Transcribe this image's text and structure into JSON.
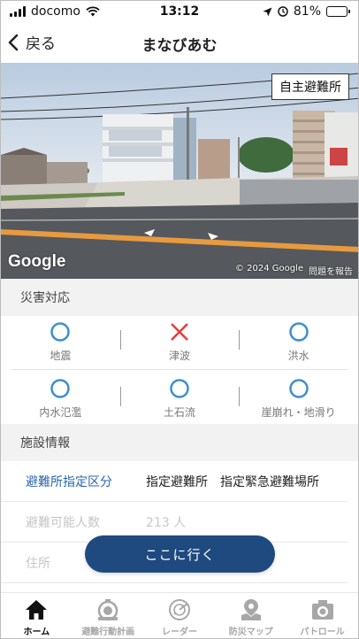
{
  "status_bar": {
    "carrier": "docomo",
    "time": "13:12",
    "battery": "81%",
    "battery_level": 0.81
  },
  "nav": {
    "back_label": "戻る",
    "title": "まなびあむ"
  },
  "street_view": {
    "tag": "自主避難所",
    "brand": "Google",
    "copyright": "© 2024 Google",
    "report": "問題を報告"
  },
  "disaster": {
    "header": "災害対応",
    "items": [
      {
        "label": "地震",
        "mark": "circle-icon",
        "color": "#3e8ed0"
      },
      {
        "label": "津波",
        "mark": "cross-icon",
        "color": "#e5403e"
      },
      {
        "label": "洪水",
        "mark": "circle-icon",
        "color": "#3e8ed0"
      },
      {
        "label": "内水氾濫",
        "mark": "circle-icon",
        "color": "#3e8ed0"
      },
      {
        "label": "土石流",
        "mark": "circle-icon",
        "color": "#3e8ed0"
      },
      {
        "label": "崖崩れ・地滑り",
        "mark": "circle-icon",
        "color": "#3e8ed0"
      }
    ]
  },
  "facility": {
    "header": "施設情報",
    "rows": [
      {
        "key": "避難所指定区分",
        "values": [
          "指定避難所",
          "指定緊急避難場所"
        ]
      },
      {
        "key": "避難可能人数",
        "values": [
          "213 人"
        ]
      },
      {
        "key": "住所",
        "values": []
      }
    ]
  },
  "go_button": "ここに行く",
  "tabs": [
    {
      "label": "ホーム",
      "icon": "home-icon",
      "active": true
    },
    {
      "label": "避難行動計画",
      "icon": "timer-icon",
      "active": false
    },
    {
      "label": "レーダー",
      "icon": "radar-icon",
      "active": false
    },
    {
      "label": "防災マップ",
      "icon": "map-pin-icon",
      "active": false
    },
    {
      "label": "パトロール",
      "icon": "camera-icon",
      "active": false
    }
  ],
  "colors": {
    "accent_blue": "#2b66b0",
    "button_navy": "#1f4a7f",
    "circle_blue": "#3e8ed0",
    "cross_red": "#e5403e"
  }
}
